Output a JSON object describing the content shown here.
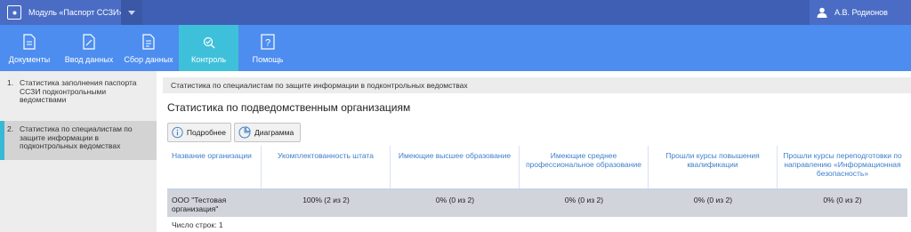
{
  "header": {
    "module_title": "Модуль «Паспорт ССЗИ»",
    "user_name": "А.В. Родионов"
  },
  "nav": {
    "tabs": [
      {
        "label": "Документы",
        "icon": "document-icon"
      },
      {
        "label": "Ввод данных",
        "icon": "data-entry-icon"
      },
      {
        "label": "Сбор данных",
        "icon": "data-collection-icon"
      },
      {
        "label": "Контроль",
        "icon": "control-icon",
        "active": true
      },
      {
        "label": "Помощь",
        "icon": "help-icon"
      }
    ]
  },
  "sidebar": {
    "items": [
      {
        "num": "1.",
        "label": "Статистика заполнения паспорта ССЗИ подконтрольными ведомствами"
      },
      {
        "num": "2.",
        "label": "Статистика по специалистам по защите информации в подконтрольных ведомствах",
        "active": true
      }
    ]
  },
  "main": {
    "breadcrumb": "Статистика по специалистам по защите информации в подконтрольных ведомствах",
    "title": "Статистика по подведомственным организациям",
    "buttons": {
      "details": "Подробнее",
      "chart": "Диаграмма"
    },
    "table": {
      "columns": [
        "Название организации",
        "Укомплектованность штата",
        "Имеющие высшее образование",
        "Имеющие среднее профессиональное образование",
        "Прошли курсы повышения квалификации",
        "Прошли курсы переподготовки по направлению «Информационная безопасность»"
      ],
      "rows": [
        [
          "ООО \"Тестовая организация\"",
          "100% (2 из 2)",
          "0% (0 из 2)",
          "0% (0 из 2)",
          "0% (0 из 2)",
          "0% (0 из 2)"
        ]
      ]
    },
    "row_count": "Число строк: 1"
  },
  "colors": {
    "top_bar": "#3e5fb3",
    "nav_bar": "#4d8def",
    "active_tab": "#3fc0da",
    "header_text": "#3d7fc9",
    "selected_row": "#d2d4dc"
  }
}
